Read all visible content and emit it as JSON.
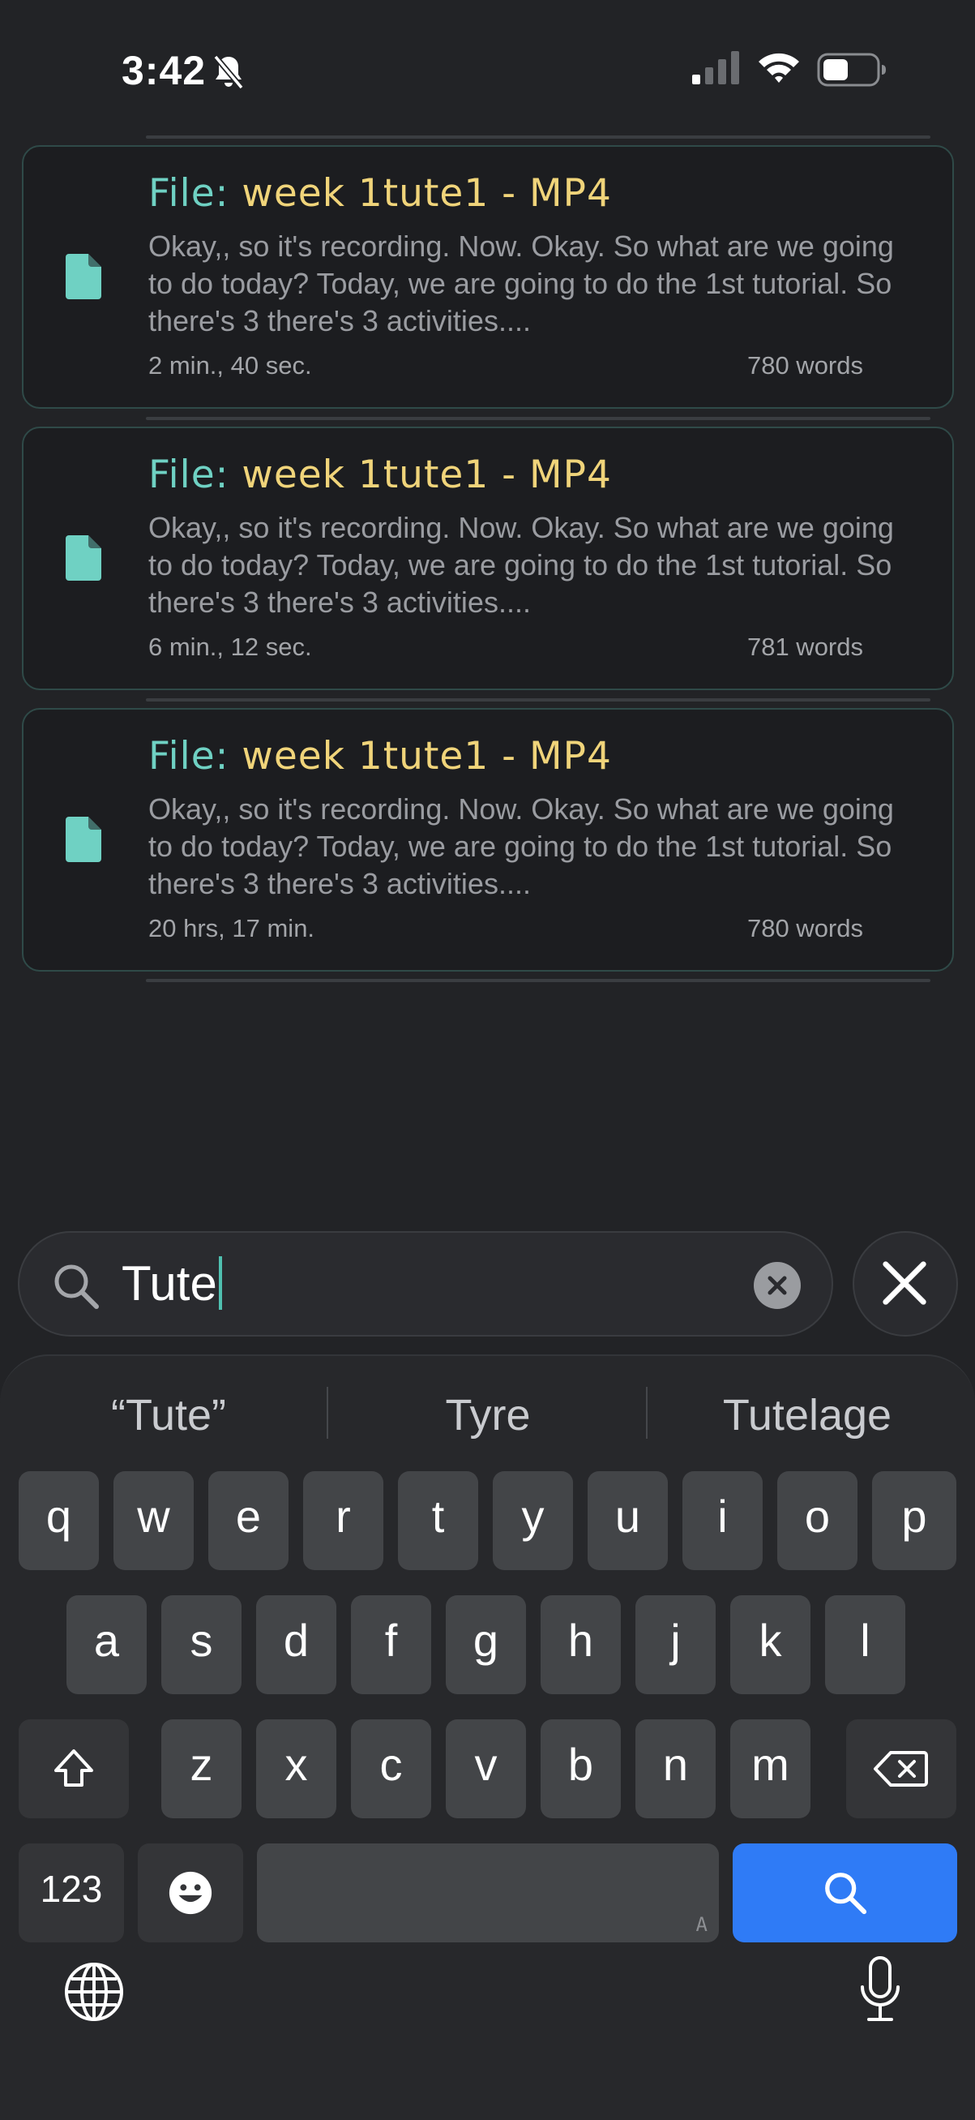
{
  "status_bar": {
    "time": "3:42",
    "icons": [
      "bell-slash-icon",
      "cellular-signal-icon",
      "wifi-icon",
      "battery-icon"
    ]
  },
  "results": [
    {
      "title_prefix": "File: ",
      "title_name": "week 1tute1 - MP4",
      "snippet": "Okay,, so it's recording. Now. Okay. So what are we going to do today? Today, we are going to do the 1st tutorial. So there's 3 there's 3 activities....",
      "duration": "2 min., 40 sec.",
      "words": "780 words"
    },
    {
      "title_prefix": "File: ",
      "title_name": "week 1tute1 - MP4",
      "snippet": "Okay,, so it's recording. Now. Okay. So what are we going to do today? Today, we are going to do the 1st tutorial. So there's 3 there's 3 activities....",
      "duration": "6 min., 12 sec.",
      "words": "781 words"
    },
    {
      "title_prefix": "File: ",
      "title_name": "week 1tute1 - MP4",
      "snippet": "Okay,, so it's recording. Now. Okay. So what are we going to do today? Today, we are going to do the 1st tutorial. So there's 3 there's 3 activities....",
      "duration": "20 hrs, 17 min.",
      "words": "780 words"
    }
  ],
  "search": {
    "value": "Tute",
    "icon": "search-icon",
    "clear_icon": "clear-circle-icon",
    "close_icon": "close-icon"
  },
  "keyboard": {
    "suggestions": [
      "“Tute”",
      "Tyre",
      "Tutelage"
    ],
    "row1": [
      "q",
      "w",
      "e",
      "r",
      "t",
      "y",
      "u",
      "i",
      "o",
      "p"
    ],
    "row2": [
      "a",
      "s",
      "d",
      "f",
      "g",
      "h",
      "j",
      "k",
      "l"
    ],
    "row3": [
      "z",
      "x",
      "c",
      "v",
      "b",
      "n",
      "m"
    ],
    "numbers_label": "123",
    "space_hint": "A",
    "accent_color": "#2f7bf6"
  },
  "colors": {
    "background": "#222326",
    "title_prefix": "#6fd1c3",
    "title_name": "#f0d47a",
    "doc_icon": "#6fd1c3"
  }
}
